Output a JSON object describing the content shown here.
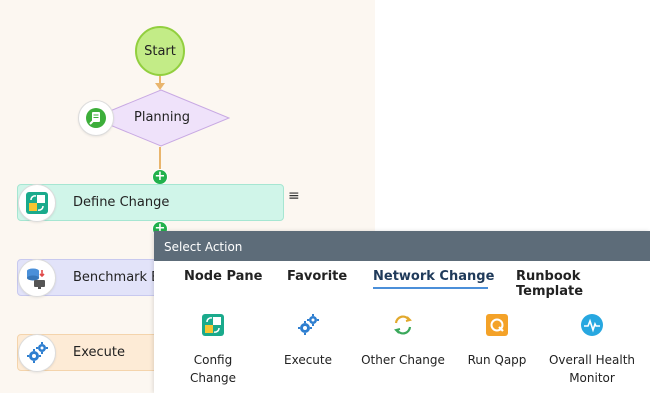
{
  "flow": {
    "start_label": "Start",
    "planning_label": "Planning",
    "define_change_label": "Define Change",
    "benchmark_label": "Benchmark B",
    "execute_label": "Execute",
    "menu_glyph": "≡",
    "plus_glyph": "+"
  },
  "select_action": {
    "title": "Select Action",
    "tabs": [
      "Node Pane",
      "Favorite",
      "Network Change",
      "Runbook Template"
    ],
    "active_tab": "Network Change",
    "actions": [
      {
        "label": "Config\nChange",
        "icon": "config-change-icon"
      },
      {
        "label": "Execute",
        "icon": "execute-gears-icon"
      },
      {
        "label": "Other Change",
        "icon": "other-change-icon"
      },
      {
        "label": "Run Qapp",
        "icon": "run-qapp-icon"
      },
      {
        "label": "Overall Health\nMonitor",
        "icon": "health-monitor-icon"
      }
    ]
  },
  "colors": {
    "canvas": "#fcf7f1",
    "start_fill": "#c3ec87",
    "planning_fill": "#efe2fa",
    "define_change_fill": "#d0f5e9",
    "benchmark_fill": "#e2e3f9",
    "execute_fill": "#fdebd6",
    "panel_header": "#5d6c79",
    "tab_underline": "#4b8fd9",
    "plus_green": "#22b14c"
  }
}
